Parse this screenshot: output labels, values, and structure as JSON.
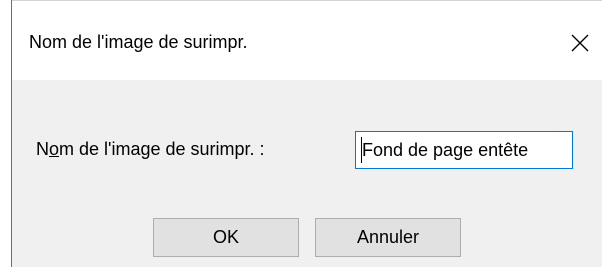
{
  "window": {
    "title": "Nom de l'image de surimpr.",
    "close_icon": "close-icon"
  },
  "form": {
    "label_prefix": "N",
    "label_mnemonic": "o",
    "label_rest": "m de l'image de surimpr. :",
    "input_value": "Fond de page entête"
  },
  "buttons": {
    "ok_label": "OK",
    "cancel_label": "Annuler"
  },
  "colors": {
    "focus_border": "#0078d7",
    "dialog_background": "#f0f0f0",
    "button_background": "#e1e1e1"
  }
}
